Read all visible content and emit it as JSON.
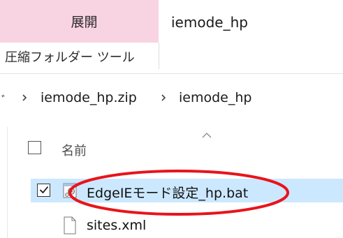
{
  "ribbon": {
    "tab_label": "展開",
    "window_title": "iemode_hp",
    "group_label": "圧縮フォルダー ツール"
  },
  "address_bar": {
    "cut_prefix": "ﾞ",
    "crumbs": [
      "iemode_hp.zip",
      "iemode_hp"
    ]
  },
  "file_list": {
    "column_name": "名前",
    "items": [
      {
        "name": "EdgeIEモード設定_hp.bat",
        "checked": true,
        "selected": true,
        "icon": "batch-file-icon"
      },
      {
        "name": "sites.xml",
        "checked": false,
        "selected": false,
        "icon": "document-file-icon"
      }
    ]
  },
  "colors": {
    "ribbon_tab_bg": "#f8d3e1",
    "selection_bg": "#cce8ff",
    "annotation_red": "#e8141b"
  }
}
